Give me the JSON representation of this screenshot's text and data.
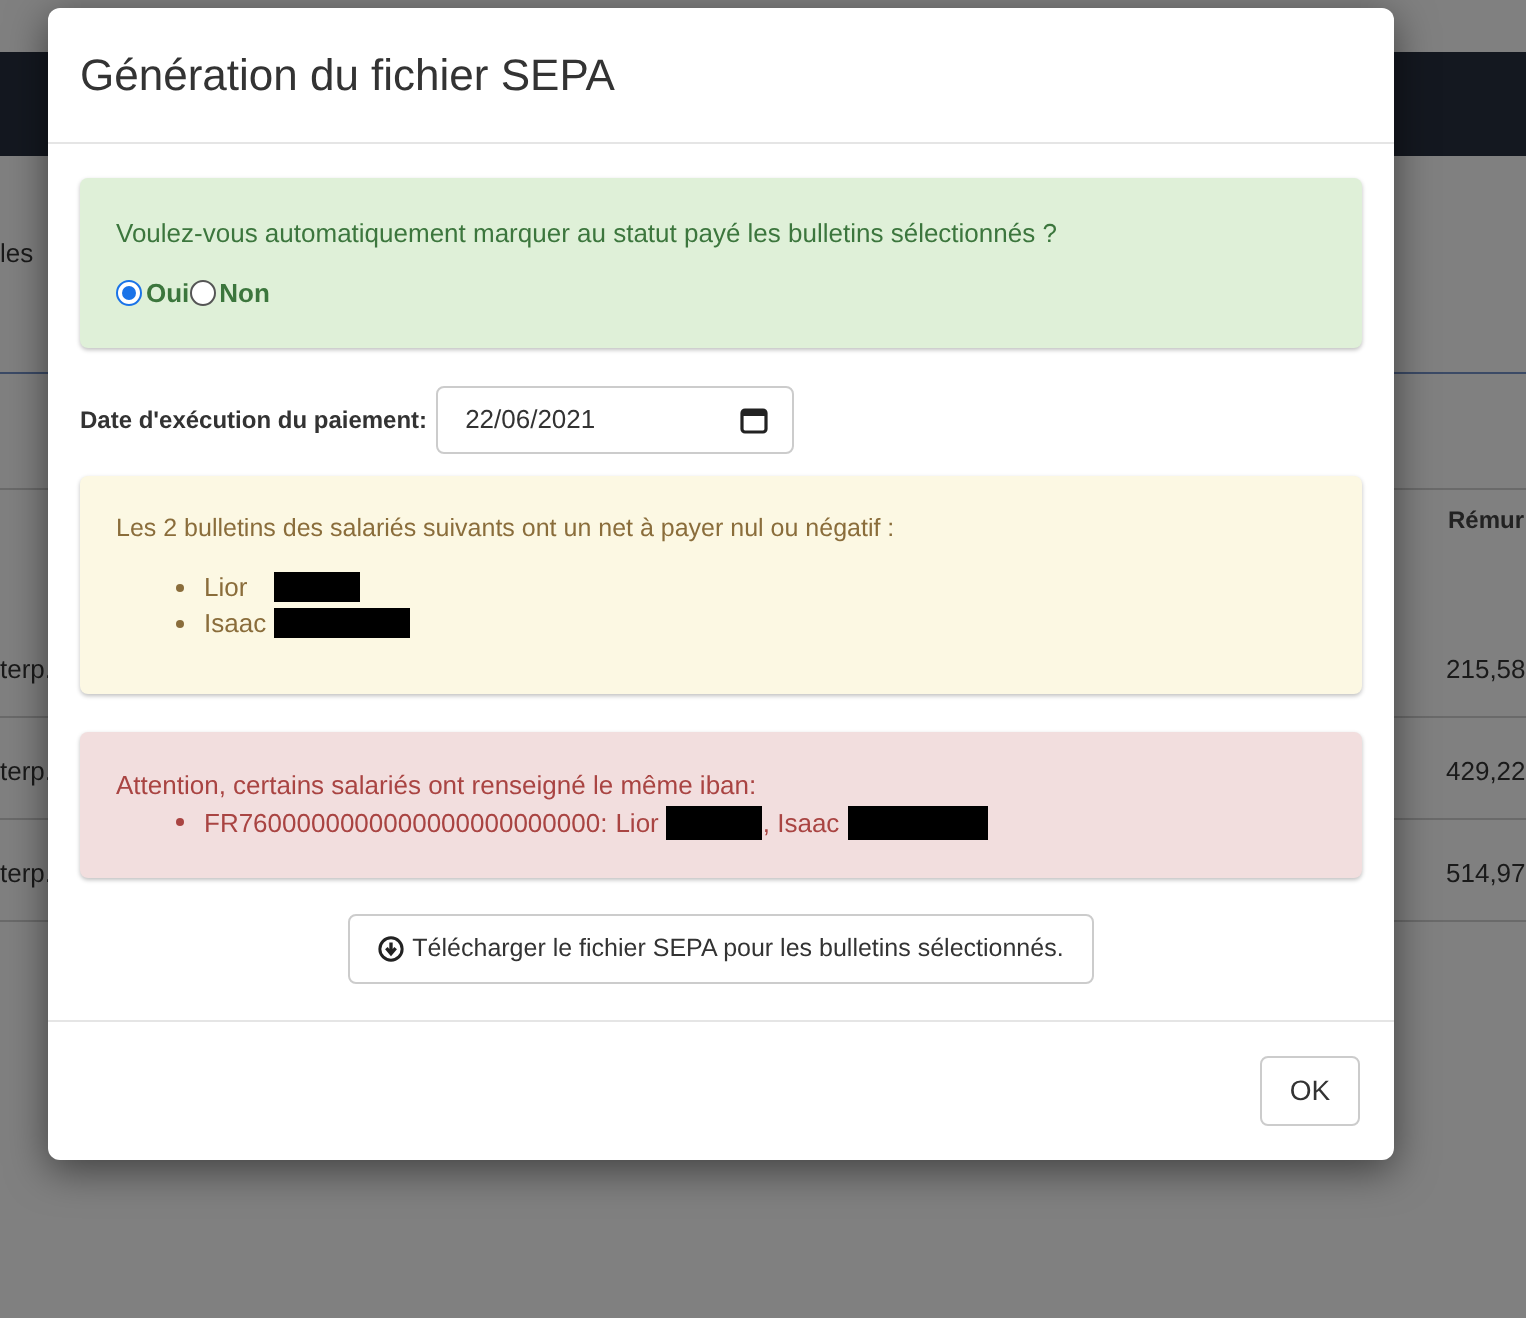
{
  "background": {
    "side_text": "les",
    "column_header": "Rémur",
    "rows": [
      {
        "cell_1": "terp.",
        "cell_2": "215,58"
      },
      {
        "cell_1": "terp.",
        "cell_2": "429,22"
      },
      {
        "cell_1": "terp.",
        "cell_2": "514,97"
      }
    ]
  },
  "dialog": {
    "title": "Génération du fichier SEPA",
    "question": {
      "text": "Voulez-vous automatiquement marquer au statut payé les bulletins sélectionnés ?",
      "options": [
        {
          "label": "Oui",
          "selected": true
        },
        {
          "label": "Non",
          "selected": false
        }
      ]
    },
    "date": {
      "label": "Date d'exécution du paiement:",
      "value": "22/06/2021"
    },
    "warning": {
      "text": "Les 2 bulletins des salariés suivants ont un net à payer nul ou négatif :",
      "items": [
        "Lior",
        "Isaac"
      ]
    },
    "iban_alert": {
      "text": "Attention, certains salariés ont renseigné le même iban:",
      "items": [
        {
          "iban": "FR7600000000000000000000000:",
          "names": [
            "Lior",
            ", Isaac"
          ]
        }
      ]
    },
    "download_button": "Télécharger le fichier SEPA pour les bulletins sélectionnés.",
    "ok_button": "OK"
  }
}
